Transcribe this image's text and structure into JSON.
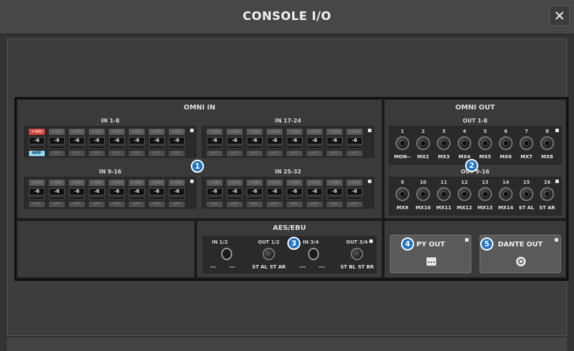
{
  "window": {
    "title": "CONSOLE I/O",
    "close_glyph": "✕"
  },
  "omni_in": {
    "title": "OMNI IN",
    "groups": [
      {
        "label": "IN 1-8",
        "phantom": "+48V",
        "gain": "-6",
        "hpf": "HPF",
        "phantom_on": [
          true,
          false,
          false,
          false,
          false,
          false,
          false,
          false
        ],
        "hpf_on": [
          true,
          false,
          false,
          false,
          false,
          false,
          false,
          false
        ]
      },
      {
        "label": "IN 17-24",
        "phantom": "+48V",
        "gain": "-6",
        "hpf": "HPF",
        "phantom_on": [
          false,
          false,
          false,
          false,
          false,
          false,
          false,
          false
        ],
        "hpf_on": [
          false,
          false,
          false,
          false,
          false,
          false,
          false,
          false
        ]
      },
      {
        "label": "IN 9-16",
        "phantom": "+48V",
        "gain": "-6",
        "hpf": "HPF",
        "phantom_on": [
          false,
          false,
          false,
          false,
          false,
          false,
          false,
          false
        ],
        "hpf_on": [
          false,
          false,
          false,
          false,
          false,
          false,
          false,
          false
        ]
      },
      {
        "label": "IN 25-32",
        "phantom": "+48V",
        "gain": "-6",
        "hpf": "HPF",
        "phantom_on": [
          false,
          false,
          false,
          false,
          false,
          false,
          false,
          false
        ],
        "hpf_on": [
          false,
          false,
          false,
          false,
          false,
          false,
          false,
          false
        ]
      }
    ]
  },
  "omni_out": {
    "title": "OMNI OUT",
    "groups": [
      {
        "label": "OUT 1-8",
        "numbers": [
          "1",
          "2",
          "3",
          "4",
          "5",
          "6",
          "7",
          "8"
        ],
        "names": [
          "MON--",
          "MX2",
          "MX3",
          "MX4",
          "MX5",
          "MX6",
          "MX7",
          "MX8"
        ]
      },
      {
        "label": "OUT 9-16",
        "numbers": [
          "9",
          "10",
          "11",
          "12",
          "13",
          "14",
          "15",
          "16"
        ],
        "names": [
          "MX9",
          "MX10",
          "MX11",
          "MX12",
          "MX13",
          "MX14",
          "ST AL",
          "ST AR"
        ]
      }
    ]
  },
  "aes_ebu": {
    "title": "AES/EBU",
    "labels": [
      "IN 1/2",
      "OUT 1/2",
      "IN 3/4",
      "OUT 3/4"
    ],
    "names": [
      "---",
      "---",
      "ST AL",
      "ST AR",
      "---",
      "---",
      "ST BL",
      "ST BR"
    ]
  },
  "buttons": {
    "py_out": "PY OUT",
    "dante_out": "DANTE OUT"
  },
  "callouts": [
    "1",
    "2",
    "3",
    "4",
    "5"
  ],
  "colors": {
    "phantom_on": "#d8463c",
    "hpf_on": "#8fd4ee",
    "callout": "#1a73c8"
  },
  "icons": {
    "close": "close-icon",
    "py_out": "card-slot-icon",
    "dante_out": "dante-icon"
  }
}
